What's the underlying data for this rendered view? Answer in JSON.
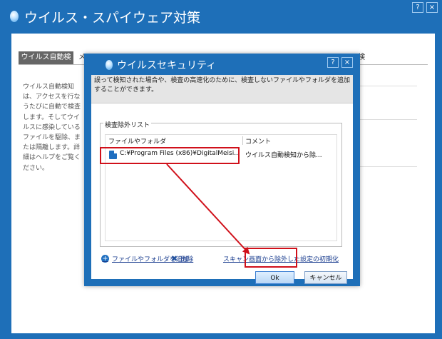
{
  "outer": {
    "title": "ウイルス・スパイウェア対策",
    "help_label": "?",
    "close_label": "×",
    "tab_active": "ウイルス自動検知",
    "tab_partial": "メ",
    "tab_right": "検",
    "description": "ウイルス自動検知は、アクセスを行なうたびに自動で検査します。そしてウイルスに感染しているファイルを駆除、または隔離します。詳細はヘルプをご覧ください。"
  },
  "dialog": {
    "title": "ウイルスセキュリティ",
    "help_label": "?",
    "close_label": "×",
    "info_text": "誤って検知された場合や、検査の高速化のために、検査しないファイルやフォルダを追加することができます。",
    "group_label": "検査除外リスト",
    "columns": [
      "ファイルやフォルダ",
      "コメント"
    ],
    "rows": [
      {
        "path": "C:¥Program Files (x86)¥DigitalMeisi...",
        "comment": "ウイルス自動検知から除..."
      }
    ],
    "add_link": "ファイルやフォルダを追加",
    "delete_link": "削除",
    "reset_link": "スキャン画面から除外した設定の初期化",
    "ok_label": "Ok",
    "cancel_label": "キャンセル"
  },
  "colors": {
    "window_blue": "#1e6fb8",
    "highlight_red": "#d0101a",
    "tab_active_bg": "#666666"
  },
  "icons": [
    "app-logo-icon",
    "file-icon",
    "plus-icon",
    "delete-x-icon"
  ]
}
